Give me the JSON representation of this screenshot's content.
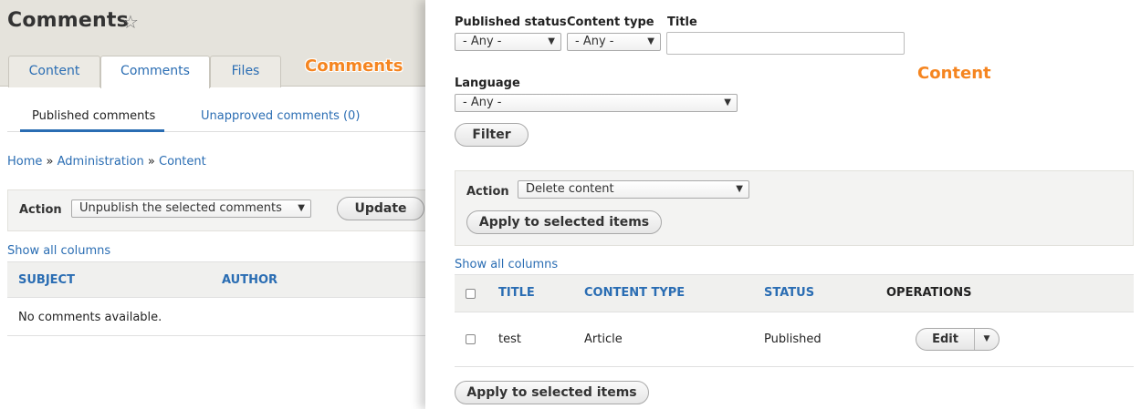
{
  "comments_pane": {
    "title": "Comments",
    "favorite_icon": "star-outline-icon",
    "callout": "Comments",
    "tabs": [
      {
        "label": "Content"
      },
      {
        "label": "Comments"
      },
      {
        "label": "Files"
      }
    ],
    "subtabs": [
      {
        "label": "Published comments"
      },
      {
        "label": "Unapproved comments (0)"
      }
    ],
    "breadcrumb": {
      "items": [
        "Home",
        "Administration",
        "Content"
      ],
      "separator": "»"
    },
    "bulk": {
      "label": "Action",
      "selected": "Unpublish the selected comments",
      "button": "Update"
    },
    "show_all_columns": "Show all columns",
    "columns": [
      "SUBJECT",
      "AUTHOR"
    ],
    "empty_message": "No comments available."
  },
  "content_pane": {
    "callout": "Content",
    "filters": {
      "published_status": {
        "label": "Published status",
        "selected": "- Any -"
      },
      "content_type": {
        "label": "Content type",
        "selected": "- Any -"
      },
      "title": {
        "label": "Title",
        "value": ""
      },
      "language": {
        "label": "Language",
        "selected": "- Any -"
      },
      "filter_button": "Filter"
    },
    "bulk": {
      "label": "Action",
      "selected": "Delete content",
      "apply_button": "Apply to selected items"
    },
    "show_all_columns": "Show all columns",
    "columns": [
      "TITLE",
      "CONTENT TYPE",
      "STATUS",
      "OPERATIONS"
    ],
    "rows": [
      {
        "title": "test",
        "content_type": "Article",
        "status": "Published",
        "operation": "Edit"
      }
    ],
    "bottom_apply_button": "Apply to selected items"
  },
  "colors": {
    "link": "#2a6db3",
    "callout": "#f58520",
    "header_bg": "#e5e3dc"
  }
}
